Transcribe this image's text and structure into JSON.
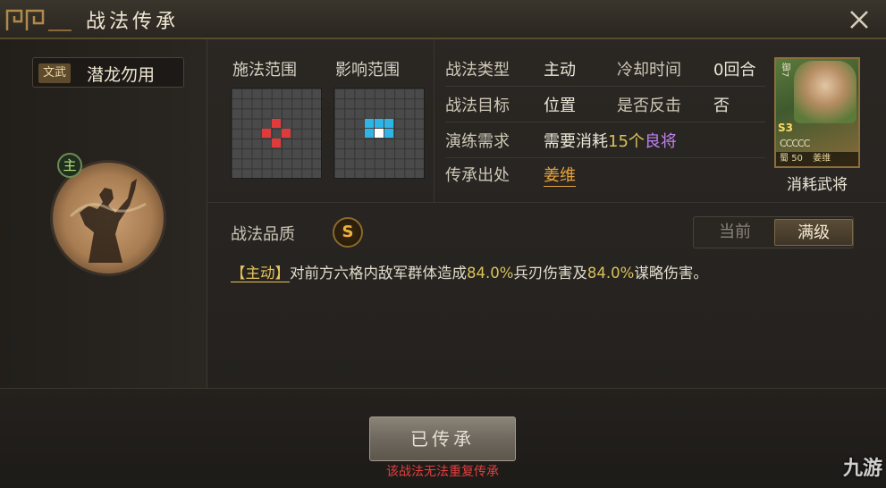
{
  "window": {
    "title": "战法传承"
  },
  "skill": {
    "type_tag": "文武",
    "name": "潜龙勿用"
  },
  "hero_badge": "主",
  "ranges": {
    "cast_label": "施法范围",
    "effect_label": "影响范围"
  },
  "info": {
    "type_label": "战法类型",
    "type_value": "主动",
    "cooldown_label": "冷却时间",
    "cooldown_value": "0回合",
    "target_label": "战法目标",
    "target_value": "位置",
    "counter_label": "是否反击",
    "counter_value": "否",
    "training_label": "演练需求",
    "training_prefix": "需要消耗",
    "training_count": "15个",
    "training_quality": "良将",
    "source_label": "传承出处",
    "source_value": "姜维"
  },
  "general_card": {
    "side_text": "御7",
    "tier": "S3",
    "stars": "CCCCC",
    "faction": "蜀",
    "cost": "50",
    "name": "姜维",
    "label": "消耗武将"
  },
  "quality": {
    "label": "战法品质",
    "grade": "S"
  },
  "level_toggle": {
    "current": "当前",
    "max": "满级"
  },
  "description": {
    "tag": "【主动】",
    "part1": "对前方六格内敌军群体造成",
    "value1": "84.0%",
    "part2": "兵刃伤害及",
    "value2": "84.0%",
    "part3": "谋略伤害。"
  },
  "actions": {
    "inherit_label": "已传承",
    "warning": "该战法无法重复传承"
  },
  "watermark": "九游",
  "colors": {
    "accent_gold": "#d8c25a",
    "cast_cell": "#e03a3a",
    "effect_cell": "#2fb4e6",
    "warning": "#e04040"
  }
}
